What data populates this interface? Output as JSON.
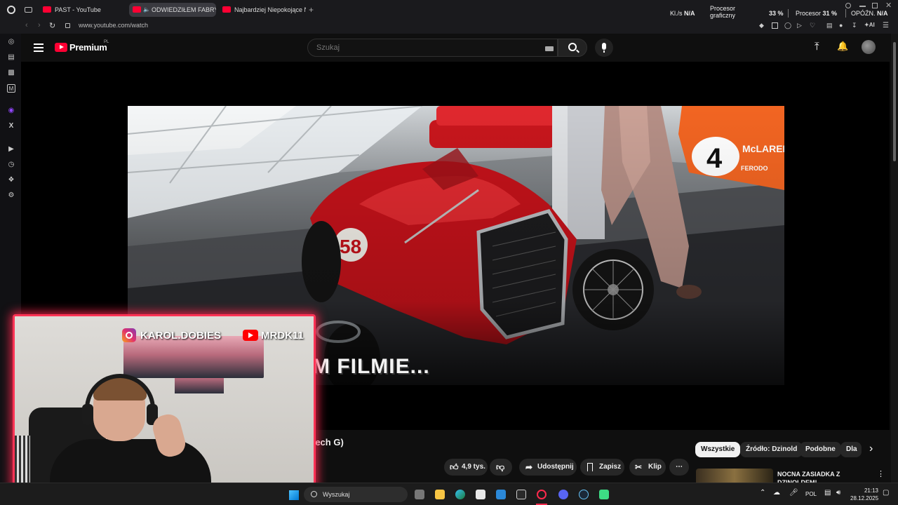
{
  "browser": {
    "tabs": [
      {
        "title": "PAST - YouTube",
        "active": false
      },
      {
        "title": "ODWIEDZIŁEM FABRY",
        "active": true
      },
      {
        "title": "Najbardziej Niepokojące N",
        "active": false
      }
    ],
    "url": "www.youtube.com/watch"
  },
  "hud": {
    "net_label": "Kl./s",
    "net_value": "N/A",
    "gpu_label_1": "Procesor",
    "gpu_label_2": "graficzny",
    "gpu_value": "33 %",
    "cpu_label": "Procesor",
    "cpu_value": "31 %",
    "latency_label": "OPÓŹN.",
    "latency_value": "N/A"
  },
  "youtube": {
    "logo_text": "Premium",
    "logo_region": "PL",
    "search_placeholder": "Szukaj",
    "video_overlay_text": "M FILMIE...",
    "title_fragment": "tech G)",
    "like_count": "4,9 tys.",
    "share_label": "Udostępnij",
    "save_label": "Zapisz",
    "clip_label": "Klip",
    "chips": [
      "Wszystkie",
      "Źródło: Dzinold",
      "Podobne",
      "Dla"
    ],
    "next_video_title_1": "NOCNA ZASIADKA Z",
    "next_video_title_2": "DZINOLDEM!"
  },
  "webcam": {
    "instagram_handle": "KAROL.DOBIES",
    "youtube_handle": "MRDK11"
  },
  "taskbar": {
    "search_label": "Wyszukaj",
    "language": "POL",
    "time": "21:13",
    "date": "28.12.2025"
  },
  "colors": {
    "yt_red": "#ff0033",
    "cam_border": "#ff3355",
    "car_red": "#c4121a",
    "mclaren_orange": "#f26522"
  }
}
